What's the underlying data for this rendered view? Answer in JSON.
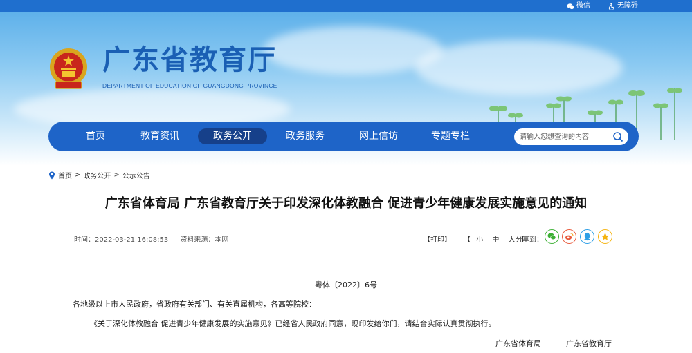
{
  "topbar": {
    "wechat_label": "微信",
    "accessibility_label": "无障碍"
  },
  "header": {
    "site_title": "广东省教育厅",
    "site_subtitle": "DEPARTMENT OF EDUCATION OF GUANGDONG PROVINCE"
  },
  "nav": {
    "items": [
      {
        "label": "首页",
        "active": false
      },
      {
        "label": "教育资讯",
        "active": false
      },
      {
        "label": "政务公开",
        "active": true
      },
      {
        "label": "政务服务",
        "active": false
      },
      {
        "label": "网上信访",
        "active": false
      },
      {
        "label": "专题专栏",
        "active": false
      }
    ],
    "search_placeholder": "请输入您想查询的内容"
  },
  "breadcrumb": {
    "items": [
      "首页",
      "政务公开",
      "公示公告"
    ],
    "separator": ">"
  },
  "article": {
    "title": "广东省体育局 广东省教育厅关于印发深化体教融合 促进青少年健康发展实施意见的通知",
    "time_label": "时间：",
    "time": "2022-03-21 16:08:53",
    "source_label": "资料来源：",
    "source": "本网",
    "print_label": "【打印】",
    "size_open": "【",
    "size_small": "小",
    "size_medium": "中",
    "size_large": "大",
    "size_close": "】",
    "share_label": "分享到：",
    "doc_number": "粤体〔2022〕6号",
    "salutation": "各地级以上市人民政府，省政府有关部门、有关直属机构，各高等院校：",
    "paragraph": "《关于深化体教融合 促进青少年健康发展的实施意见》已经省人民政府同意，现印发给你们，请结合实际认真贯彻执行。",
    "signer_1": "广东省体育局",
    "signer_2": "广东省教育厅"
  },
  "colors": {
    "topbar": "#1f6fce",
    "nav": "#1e64c8",
    "nav_active": "#16408a",
    "title_blue": "#1a5fb4",
    "share_wechat": "#3cb034",
    "share_weibo": "#e85a3c",
    "share_qq": "#2e9fe6",
    "share_qzone": "#f5b30f"
  },
  "icons": [
    "wechat-icon",
    "accessibility-icon",
    "national-emblem",
    "search-icon",
    "location-pin-icon",
    "share-wechat-icon",
    "share-weibo-icon",
    "share-qq-icon",
    "share-qzone-icon"
  ]
}
